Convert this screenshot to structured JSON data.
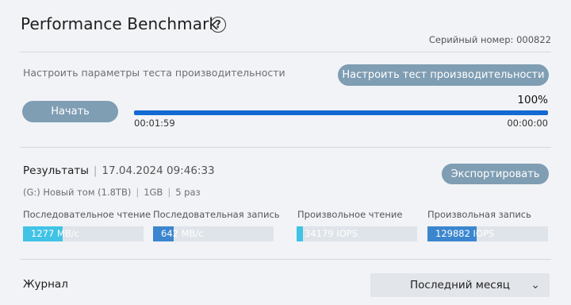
{
  "header": {
    "title": "Performance Benchmark",
    "help_icon": "question-circle-icon",
    "serial": "Серийный номер: 000822"
  },
  "config": {
    "description": "Настроить параметры теста производительности",
    "configure_label": "Настроить тест производительности"
  },
  "run": {
    "start_label": "Начать",
    "progress_percent": 100,
    "progress_label": "100%",
    "elapsed": "00:01:59",
    "remaining": "00:00:00"
  },
  "results": {
    "title": "Результаты",
    "date": "17.04.2024 09:46:33",
    "drive": "(G:) Новый том (1.8TB)",
    "size": "1GB",
    "runs": "5 раз",
    "export_label": "Экспортировать",
    "metrics": [
      {
        "label": "Последовательное чтение",
        "value": "1277 MB/с",
        "fraction": 0.33,
        "color": "#41c3e6"
      },
      {
        "label": "Последовательная запись",
        "value": "642 MB/с",
        "fraction": 0.17,
        "color": "#3b86cf"
      },
      {
        "label": "Произвольное чтение",
        "value": "34179 IOPS",
        "fraction": 0.05,
        "color": "#41c3e6"
      },
      {
        "label": "Произвольная запись",
        "value": "129882 IOPS",
        "fraction": 0.41,
        "color": "#3b86cf"
      }
    ]
  },
  "journal": {
    "title": "Журнал",
    "period_selected": "Последний месяц"
  },
  "colors": {
    "accent": "#1269d3",
    "button": "#7f9db3",
    "background": "#f1f3f6"
  }
}
